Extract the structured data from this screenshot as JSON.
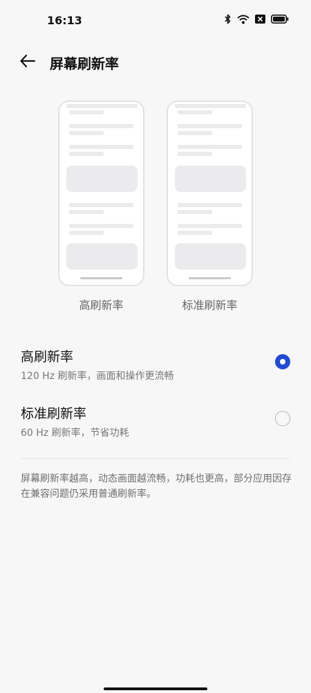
{
  "status_bar": {
    "time": "16:13",
    "icons": [
      "bluetooth-icon",
      "wifi-icon",
      "sim-disabled-icon",
      "battery-icon"
    ]
  },
  "header": {
    "title": "屏幕刷新率",
    "back_icon": "arrow-left-icon"
  },
  "previews": [
    {
      "label": "高刷新率"
    },
    {
      "label": "标准刷新率"
    }
  ],
  "options": [
    {
      "title": "高刷新率",
      "description": "120 Hz 刷新率，画面和操作更流畅",
      "selected": true
    },
    {
      "title": "标准刷新率",
      "description": "60 Hz 刷新率，节省功耗",
      "selected": false
    }
  ],
  "footnote": "屏幕刷新率越高，动态画面越流畅，功耗也更高，部分应用因存在兼容问题仍采用普通刷新率。",
  "colors": {
    "accent": "#2249d6",
    "background": "#f7f7f7"
  }
}
